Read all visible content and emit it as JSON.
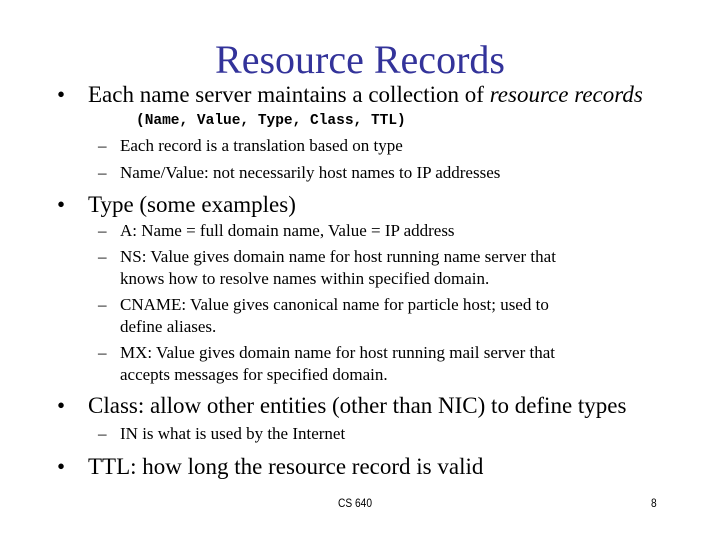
{
  "slide": {
    "title": "Resource Records",
    "bullets": [
      {
        "text": "Each name server maintains a collection of ",
        "text_italic": "resource records",
        "code_line": "(Name, Value, Type, Class, TTL)",
        "sub": [
          {
            "lines": [
              "Each record is a translation based on type"
            ]
          },
          {
            "lines": [
              "Name/Value: not necessarily host names to IP addresses"
            ]
          }
        ]
      },
      {
        "text": "Type (some examples)",
        "sub": [
          {
            "lines": [
              "A:  Name = full domain name, Value = IP address"
            ]
          },
          {
            "lines": [
              "NS: Value gives domain name for host running name server that",
              "knows how to resolve names within specified domain."
            ]
          },
          {
            "lines": [
              "CNAME: Value gives canonical name for particle host; used to",
              "define aliases."
            ]
          },
          {
            "lines": [
              "MX: Value gives domain name for host running mail server that",
              "accepts messages for specified domain."
            ]
          }
        ]
      },
      {
        "text": "Class: allow other entities (other than NIC) to define types",
        "sub": [
          {
            "lines": [
              "IN  is what is used by the Internet"
            ]
          }
        ]
      },
      {
        "text": "TTL: how long the resource record is valid",
        "sub": []
      }
    ],
    "bullet_glyph": "•",
    "dash_glyph": "–",
    "footer_center": "CS 640",
    "page_number": "8",
    "title_color": "#33339a"
  }
}
